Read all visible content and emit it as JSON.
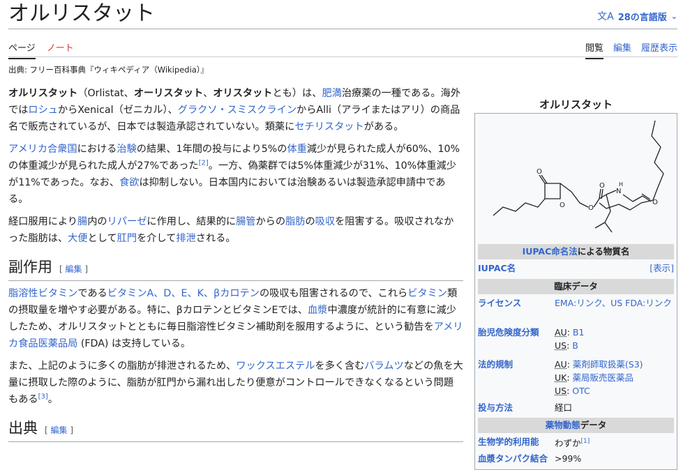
{
  "page": {
    "title": "オルリスタット",
    "lang_label": "28の言語版",
    "tabs_left": [
      {
        "label": "ページ"
      },
      {
        "label": "ノート"
      }
    ],
    "tabs_right": [
      {
        "label": "閲覧"
      },
      {
        "label": "編集"
      },
      {
        "label": "履歴表示"
      }
    ],
    "from": "出典: フリー百科事典『ウィキペディア（Wikipedia）』"
  },
  "article": {
    "p1": [
      {
        "t": "オルリスタット",
        "b": true
      },
      {
        "t": "（Orlistat、"
      },
      {
        "t": "オーリスタット",
        "b": true
      },
      {
        "t": "、"
      },
      {
        "t": "オリスタット",
        "b": true
      },
      {
        "t": "とも）は、"
      },
      {
        "t": "肥満",
        "l": true
      },
      {
        "t": "治療薬の一種である。海外では"
      },
      {
        "t": "ロシュ",
        "l": true
      },
      {
        "t": "からXenical（ゼニカル）、"
      },
      {
        "t": "グラクソ・スミスクライン",
        "l": true
      },
      {
        "t": "からAlli（アライまたはアリ）の商品名で販売されているが、日本では製造承認されていない。類薬に"
      },
      {
        "t": "セチリスタット",
        "l": true
      },
      {
        "t": "がある。"
      }
    ],
    "p2": [
      {
        "t": "アメリカ合衆国",
        "l": true
      },
      {
        "t": "における"
      },
      {
        "t": "治験",
        "l": true
      },
      {
        "t": "の結果、1年間の投与により5%の"
      },
      {
        "t": "体重",
        "l": true
      },
      {
        "t": "減少が見られた成人が60%、10%の体重減少が見られた成人が27%であった"
      },
      {
        "t": "[2]",
        "s": true
      },
      {
        "t": "。一方、偽薬群では5%体重減少が31%、10%体重減少が11%であった。なお、"
      },
      {
        "t": "食欲",
        "l": true
      },
      {
        "t": "は抑制しない。日本国内においては治験あるいは製造承認申請中である。"
      }
    ],
    "p3": [
      {
        "t": "経口服用により"
      },
      {
        "t": "腸",
        "l": true
      },
      {
        "t": "内の"
      },
      {
        "t": "リパーゼ",
        "l": true
      },
      {
        "t": "に作用し、結果的に"
      },
      {
        "t": "腸管",
        "l": true
      },
      {
        "t": "からの"
      },
      {
        "t": "脂肪",
        "l": true
      },
      {
        "t": "の"
      },
      {
        "t": "吸収",
        "l": true
      },
      {
        "t": "を阻害する。吸収されなかった脂肪は、"
      },
      {
        "t": "大便",
        "l": true
      },
      {
        "t": "として"
      },
      {
        "t": "肛門",
        "l": true
      },
      {
        "t": "を介して"
      },
      {
        "t": "排泄",
        "l": true
      },
      {
        "t": "される。"
      }
    ],
    "h_side": "副作用",
    "h_side_edit": "編集",
    "p4": [
      {
        "t": "脂溶性ビタミン",
        "l": true
      },
      {
        "t": "である"
      },
      {
        "t": "ビタミンA、D、E、K、βカロテン",
        "l": true
      },
      {
        "t": "の吸収も阻害されるので、これら"
      },
      {
        "t": "ビタミン",
        "l": true
      },
      {
        "t": "類の摂取量を増やす必要がある。特に、βカロテンとビタミンEでは、"
      },
      {
        "t": "血漿",
        "l": true
      },
      {
        "t": "中濃度が統計的に有意に減少したため、オルリスタットとともに毎日脂溶性ビタミン補助剤を服用するように、という勧告を"
      },
      {
        "t": "アメリカ食品医薬品局",
        "l": true
      },
      {
        "t": " (FDA) は支持している。"
      }
    ],
    "p5": [
      {
        "t": "また、上記のように多くの脂肪が排泄されるため、"
      },
      {
        "t": "ワックスエステル",
        "l": true
      },
      {
        "t": "を多く含む"
      },
      {
        "t": "バラムツ",
        "l": true
      },
      {
        "t": "などの魚を大量に摂取した際のように、脂肪が肛門から漏れ出したり便意がコントロールできなくなるという問題もある"
      },
      {
        "t": "[3]",
        "s": true
      },
      {
        "t": "。"
      }
    ],
    "h_src": "出典",
    "h_src_edit": "編集"
  },
  "infobox": {
    "caption": "オルリスタット",
    "iupac_header_link": "IUPAC命名法",
    "iupac_header_rest": "による物質名",
    "iupac_label": "IUPAC名",
    "iupac_show": "[表示]",
    "clinical_header": "臨床データ",
    "license_label": "ライセンス",
    "license_value": "EMA:リンク、US FDA:リンク",
    "preg_label": "胎児危険度分類",
    "preg_au_c": "AU",
    "preg_au_v": "B1",
    "preg_us_c": "US",
    "preg_us_v": "B",
    "legal_label": "法的規制",
    "legal_au_c": "AU",
    "legal_au_v": "薬剤師取扱薬(S3)",
    "legal_uk_c": "UK",
    "legal_uk_v": "薬局販売医薬品",
    "legal_us_c": "US",
    "legal_us_v": "OTC",
    "route_label": "投与方法",
    "route_value": "経口",
    "pk_header_link": "薬物動態",
    "pk_header_rest": "データ",
    "bio_label": "生物学的利用能",
    "bio_value": "わずか",
    "bio_ref": "[1]",
    "protein_label": "血漿タンパク結合",
    "protein_value": ">99%"
  }
}
